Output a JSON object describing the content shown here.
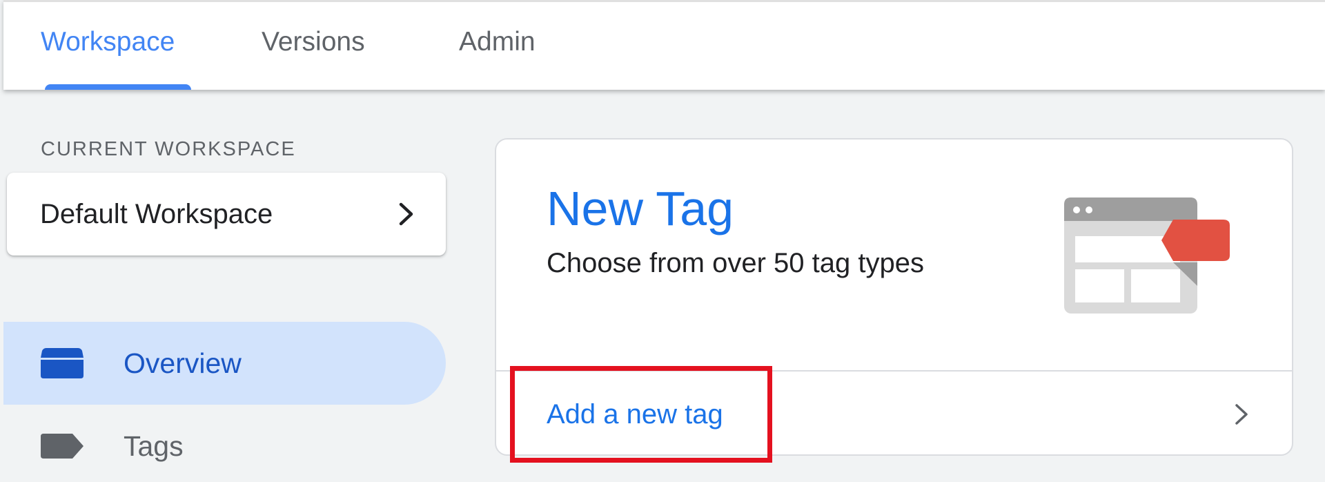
{
  "tabs": [
    {
      "label": "Workspace",
      "active": true
    },
    {
      "label": "Versions",
      "active": false
    },
    {
      "label": "Admin",
      "active": false
    }
  ],
  "sidebar": {
    "current_workspace_label": "CURRENT WORKSPACE",
    "workspace_name": "Default Workspace",
    "workspace_chevron_icon": "chevron-right-icon",
    "items": [
      {
        "label": "Overview",
        "icon": "overview-icon",
        "active": true
      },
      {
        "label": "Tags",
        "icon": "tag-icon",
        "active": false
      }
    ]
  },
  "new_tag_card": {
    "title": "New Tag",
    "subtitle": "Choose from over 50 tag types",
    "illustration_icon": "tag-browser-illustration-icon",
    "action_label": "Add a new tag",
    "action_chevron_icon": "chevron-right-icon"
  },
  "colors": {
    "accent_blue": "#1a73e8",
    "tab_active": "#4285f4",
    "nav_active_bg": "#d2e3fc",
    "highlight_red": "#e4111f",
    "tag_red": "#e25142"
  }
}
